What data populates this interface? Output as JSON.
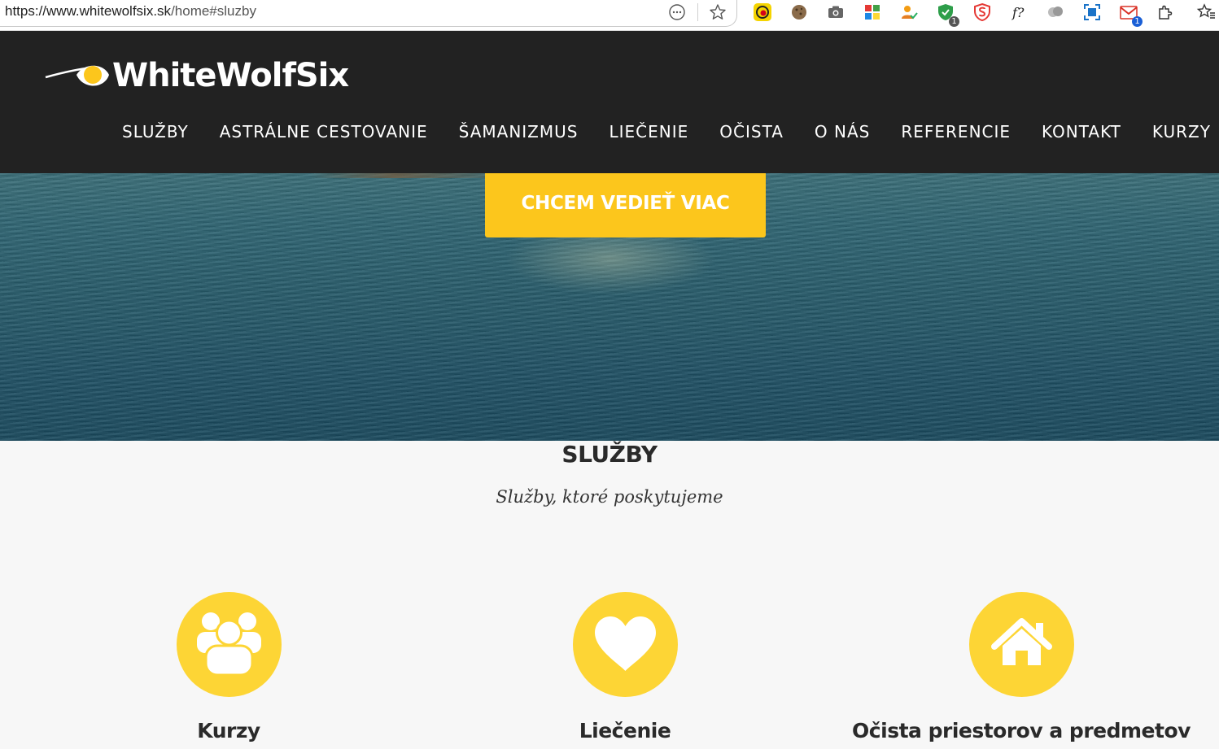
{
  "browser": {
    "url_domain": "https://www.whitewolfsix.sk",
    "url_path": "/home#sluzby",
    "extensions": [
      "reader-icon",
      "reading-list-star-icon",
      "yellow-circle-extension-icon",
      "cookie-extension-icon",
      "camera-extension-icon",
      "puzzle-color-extension-icon",
      "person-check-extension-icon",
      "shield-check-extension-icon",
      "red-s-extension-icon",
      "font-finder-extension-icon",
      "cloud-extension-icon",
      "screenshot-extension-icon",
      "gmail-extension-icon",
      "extensions-puzzle-icon",
      "favorites-star-icon"
    ],
    "badge_shield": "1",
    "badge_gmail": "1"
  },
  "site": {
    "logo_text": "WhiteWolfSix",
    "nav": [
      "SLUŽBY",
      "ASTRÁLNE CESTOVANIE",
      "ŠAMANIZMUS",
      "LIEČENIE",
      "OČISTA",
      "O NÁS",
      "REFERENCIE",
      "KONTAKT",
      "KURZY"
    ]
  },
  "hero": {
    "cta_label": "CHCEM VEDIEŤ VIAC"
  },
  "services": {
    "title": "SLUŽBY",
    "subtitle": "Služby, ktoré poskytujeme",
    "items": [
      {
        "name": "Kurzy",
        "icon": "group-icon"
      },
      {
        "name": "Liečenie",
        "icon": "heart-icon"
      },
      {
        "name": "Očista priestorov a predmetov",
        "icon": "house-icon"
      }
    ]
  },
  "colors": {
    "accent": "#fcc61c",
    "circle": "#fdd535",
    "header_bg": "#222222"
  }
}
